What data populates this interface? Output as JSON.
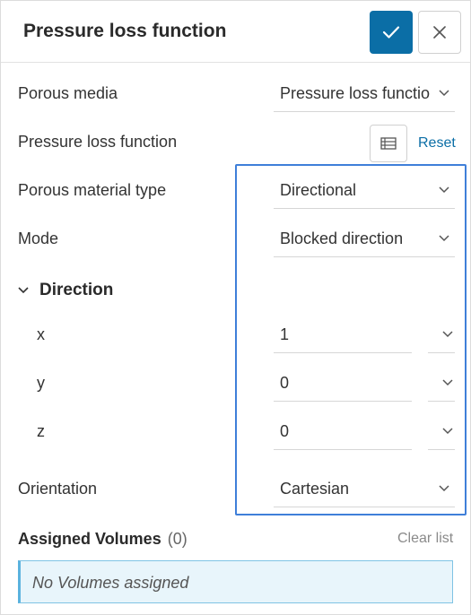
{
  "header": {
    "title": "Pressure loss function",
    "confirm_icon": "check-icon",
    "close_icon": "close-icon"
  },
  "fields": {
    "porous_media": {
      "label": "Porous media",
      "value": "Pressure loss functio"
    },
    "pressure_loss_function": {
      "label": "Pressure loss function",
      "table_icon": "table-icon",
      "reset_label": "Reset"
    },
    "porous_material_type": {
      "label": "Porous material type",
      "value": "Directional"
    },
    "mode": {
      "label": "Mode",
      "value": "Blocked direction"
    },
    "direction": {
      "label": "Direction",
      "x": {
        "label": "x",
        "value": "1"
      },
      "y": {
        "label": "y",
        "value": "0"
      },
      "z": {
        "label": "z",
        "value": "0"
      }
    },
    "orientation": {
      "label": "Orientation",
      "value": "Cartesian"
    }
  },
  "assigned_volumes": {
    "title": "Assigned Volumes",
    "count": "(0)",
    "clear_label": "Clear list",
    "empty_text": "No Volumes assigned"
  },
  "colors": {
    "accent": "#0b6ea6",
    "highlight_border": "#3f7fd9",
    "empty_box_bg": "#e8f5fb"
  }
}
